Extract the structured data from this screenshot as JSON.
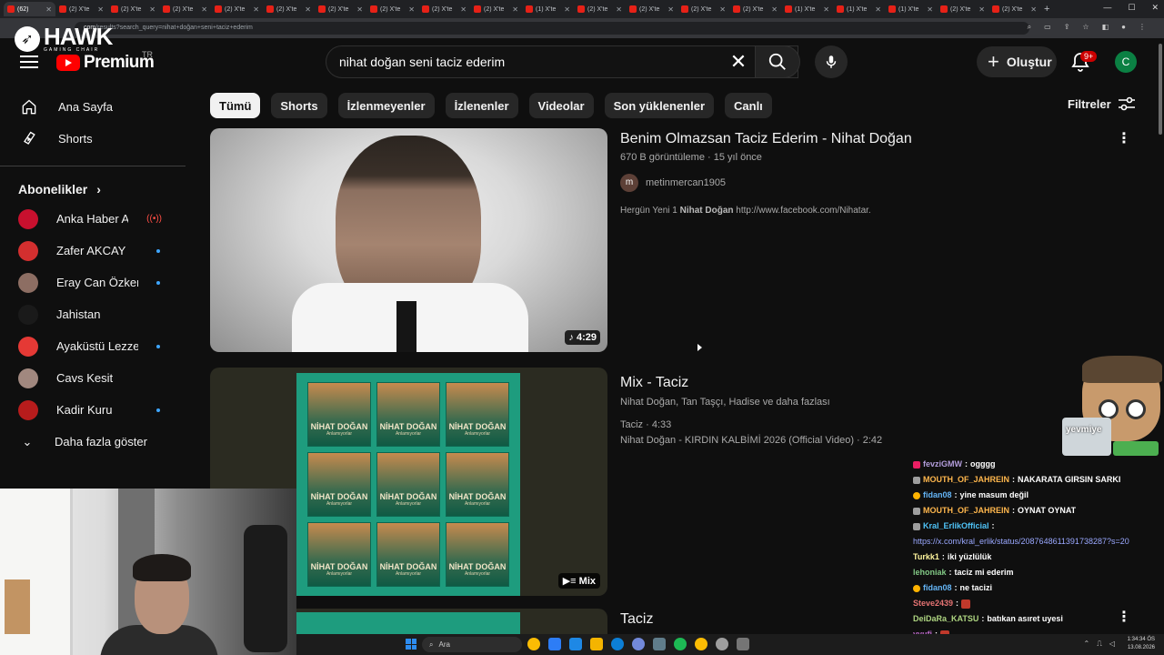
{
  "browser": {
    "tabs": [
      {
        "label": "(62)",
        "active": true
      },
      {
        "label": "(2) X'te"
      },
      {
        "label": "(2) X'te"
      },
      {
        "label": "(2) X'te"
      },
      {
        "label": "(2) X'te"
      },
      {
        "label": "(2) X'te"
      },
      {
        "label": "(2) X'te"
      },
      {
        "label": "(2) X'te"
      },
      {
        "label": "(2) X'te"
      },
      {
        "label": "(2) X'te"
      },
      {
        "label": "(1) X'te"
      },
      {
        "label": "(2) X'te"
      },
      {
        "label": "(2) X'te"
      },
      {
        "label": "(2) X'te"
      },
      {
        "label": "(2) X'te"
      },
      {
        "label": "(1) X'te"
      },
      {
        "label": "(1) X'te"
      },
      {
        "label": "(1) X'te"
      },
      {
        "label": "(2) X'te"
      },
      {
        "label": "(2) X'te"
      }
    ],
    "url_host": "com",
    "url_path": "/results?search_query=nihat+doğan+seni+taciz+ederim"
  },
  "overlay": {
    "logo_name": "HAWK",
    "logo_sub": "GAMING CHAIR",
    "emote_text": "yevmiye"
  },
  "header": {
    "logo_text": "Premium",
    "country_code": "TR",
    "search_value": "nihat doğan seni taciz ederim",
    "create_label": "Oluştur",
    "notification_count": "9+",
    "avatar_letter": "C"
  },
  "sidebar": {
    "items": [
      {
        "label": "Ana Sayfa",
        "icon": "home-icon"
      },
      {
        "label": "Shorts",
        "icon": "shorts-icon"
      }
    ],
    "subscriptions_heading": "Abonelikler",
    "subscriptions": [
      {
        "name": "Anka Haber Ajansı",
        "live": true,
        "color": "#c8102e"
      },
      {
        "name": "Zafer AKCAY",
        "dot": true,
        "color": "#d32f2f"
      },
      {
        "name": "Eray Can Özkenar",
        "dot": true,
        "color": "#8d6e63"
      },
      {
        "name": "Jahistan",
        "dot": false,
        "color": "#1a1a1a"
      },
      {
        "name": "Ayaküstü Lezzetl...",
        "dot": true,
        "color": "#e53935"
      },
      {
        "name": "Cavs Kesit",
        "dot": false,
        "color": "#a1887f"
      },
      {
        "name": "Kadir Kuru",
        "dot": true,
        "color": "#b71c1c"
      }
    ],
    "show_more_label": "Daha fazla göster"
  },
  "chips": [
    "Tümü",
    "Shorts",
    "İzlenmeyenler",
    "İzlenenler",
    "Videolar",
    "Son yüklenenler",
    "Canlı"
  ],
  "filters_label": "Filtreler",
  "results": [
    {
      "title": "Benim Olmazsan Taciz Ederim - Nihat Doğan",
      "meta": "670 B görüntüleme · 15 yıl önce",
      "channel": "metinmercan1905",
      "channel_initial": "m",
      "desc_pre": "Hergün Yeni 1 ",
      "desc_bold": "Nihat Doğan",
      "desc_post": " http://www.facebook.com/Nihatar.",
      "duration": "4:29"
    },
    {
      "title": "Mix - Taciz",
      "meta": "Nihat Doğan, Tan Taşçı, Hadise ve daha fazlası",
      "line1": "Taciz · 4:33",
      "line2": "Nihat Doğan - KIRDIN KALBİMİ 2026 (Official Video) · 2:42",
      "badge": "Mix",
      "album_title": "NİHAT DOĞAN",
      "album_sub": "Anlamıyorlar"
    },
    {
      "title": "Taciz"
    }
  ],
  "chat": [
    {
      "user": "fevziGMW",
      "text": "ogggg",
      "color": "#b39ddb",
      "badge": "sub"
    },
    {
      "user": "MOUTH_OF_JAHREIN",
      "text": "NAKARATA GIRSIN SARKI",
      "color": "#ffb74d",
      "badge": "plain"
    },
    {
      "user": "fidan08",
      "text": "yine masum değil",
      "color": "#64b5f6",
      "badge": "mod"
    },
    {
      "user": "MOUTH_OF_JAHREIN",
      "text": "OYNAT OYNAT",
      "color": "#ffb74d",
      "badge": "plain"
    },
    {
      "user": "Kral_ErlikOfficial",
      "text": "",
      "color": "#4fc3f7",
      "badge": "plain"
    },
    {
      "link": "https://x.com/kral_erlik/status/2087648611391738287?s=20"
    },
    {
      "user": "Turkk1",
      "text": "iki yüzlülük",
      "color": "#fff59d",
      "badge": "none"
    },
    {
      "user": "lehoniak",
      "text": "taciz mi ederim",
      "color": "#81c784",
      "badge": "none"
    },
    {
      "user": "fidan08",
      "text": "ne tacizi",
      "color": "#64b5f6",
      "badge": "mod"
    },
    {
      "user": "Steve2439",
      "text": "",
      "color": "#e57373",
      "badge": "none",
      "emote": true
    },
    {
      "user": "DeiDaRa_KATSU",
      "text": "batıkan asıret uyesi",
      "color": "#aed581",
      "badge": "none"
    },
    {
      "user": "yyufi",
      "text": "",
      "color": "#ba68c8",
      "badge": "none",
      "emote": true
    }
  ],
  "taskbar": {
    "search_label": "Ara",
    "time": "1:34:34 ÖS",
    "date": "13.08.2026"
  }
}
